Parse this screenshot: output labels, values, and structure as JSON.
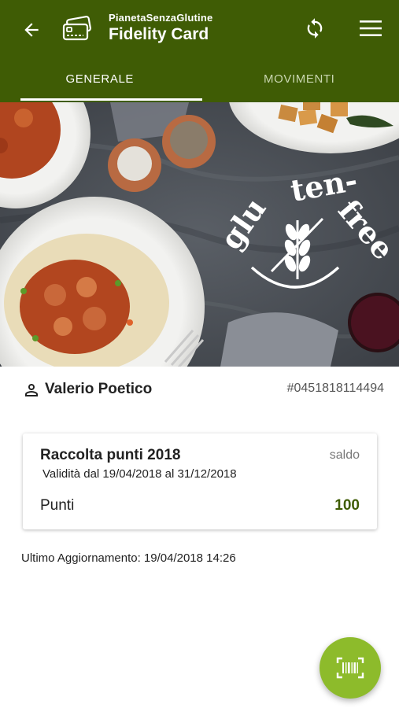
{
  "header": {
    "brand": "PianetaSenzaGlutine",
    "title": "Fidelity Card",
    "bg_color": "#3f5c05",
    "icons": [
      "back-arrow-icon",
      "card-icon",
      "sync-icon",
      "menu-icon"
    ]
  },
  "tabs": [
    {
      "label": "GENERALE",
      "active": true
    },
    {
      "label": "MOVIMENTI",
      "active": false
    }
  ],
  "hero": {
    "logo_text": "gluten-free"
  },
  "profile": {
    "name": "Valerio Poetico",
    "card_number": "#0451818114494"
  },
  "points_card": {
    "title": "Raccolta punti 2018",
    "balance_label": "saldo",
    "validity": "Validità dal 19/04/2018 al 31/12/2018",
    "points_label": "Punti",
    "points_value": "100",
    "accent_color": "#3f5c05"
  },
  "last_update": "Ultimo Aggiornamento: 19/04/2018 14:26",
  "fab": {
    "icon": "barcode-scan-icon",
    "color": "#8dbb2b"
  }
}
